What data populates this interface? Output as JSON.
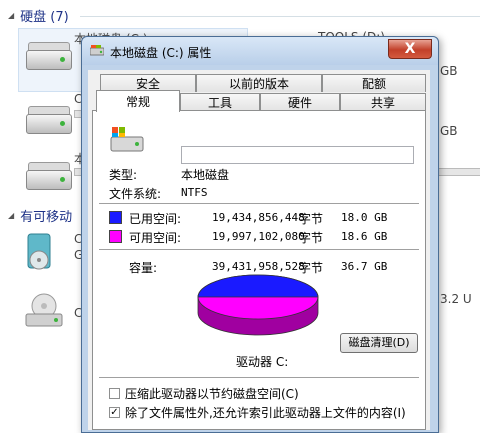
{
  "explorer": {
    "group_hdd": "硬盘 (7)",
    "group_removable": "有可移动",
    "drive_c_name": "本地磁盘 (C:)",
    "drive_tools_name": "TOOLS (D:)",
    "tools_size_text": "GB",
    "row2_text": "C",
    "row2_size": "GB",
    "row3_text": "本",
    "removable1_text": "C",
    "removable1_sub": "G",
    "removable2_text": "C",
    "removable2_size": "3.2 U"
  },
  "dialog": {
    "title": "本地磁盘 (C:) 属性",
    "close_label": "X",
    "tabs_row1": [
      "安全",
      "以前的版本",
      "配额"
    ],
    "tabs_row2": [
      "常规",
      "工具",
      "硬件",
      "共享"
    ],
    "active_tab": "常规",
    "general": {
      "type_label": "类型:",
      "type_value": "本地磁盘",
      "fs_label": "文件系统:",
      "fs_value": "NTFS",
      "used_label": "已用空间:",
      "used_bytes": "19,434,856,448",
      "used_unit": "字节",
      "used_gb": "18.0 GB",
      "free_label": "可用空间:",
      "free_bytes": "19,997,102,080",
      "free_unit": "字节",
      "free_gb": "18.6 GB",
      "capacity_label": "容量:",
      "capacity_bytes": "39,431,958,528",
      "capacity_unit": "字节",
      "capacity_gb": "36.7 GB",
      "drive_label": "驱动器 C:",
      "cleanup_button": "磁盘清理(D)",
      "compress_label": "压缩此驱动器以节约磁盘空间(C)",
      "compress_checked": false,
      "index_label": "除了文件属性外,还允许索引此驱动器上文件的内容(I)",
      "index_checked": true
    },
    "colors": {
      "used": "#1a1aff",
      "free": "#ff00ff",
      "annotation_arrow": "#e8232a"
    }
  }
}
